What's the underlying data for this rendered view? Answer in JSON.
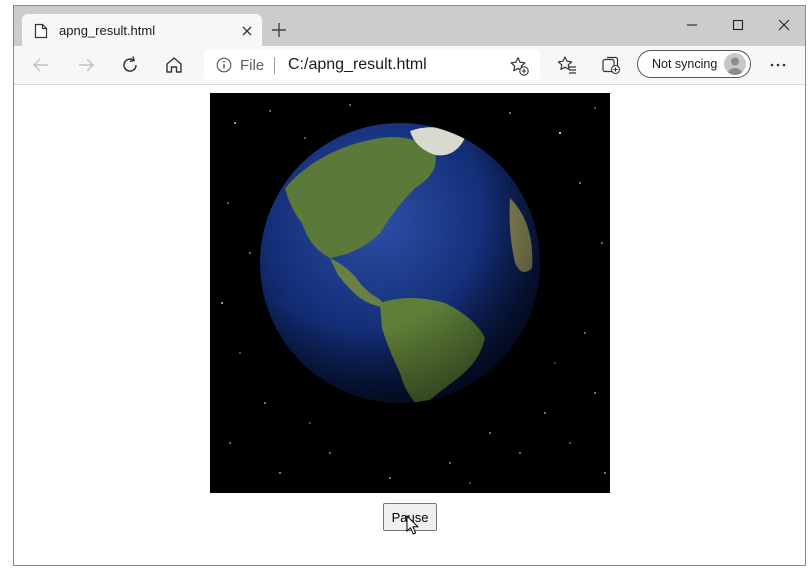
{
  "tab": {
    "title": "apng_result.html"
  },
  "address_bar": {
    "scheme_label": "File",
    "url": "C:/apng_result.html"
  },
  "profile": {
    "sync_label": "Not syncing"
  },
  "content": {
    "button_label": "Pause"
  },
  "icons": [
    "page-icon",
    "close-icon",
    "plus-icon",
    "minimize-icon",
    "maximize-icon",
    "back-arrow-icon",
    "forward-arrow-icon",
    "refresh-icon",
    "home-icon",
    "info-icon",
    "add-favorite-icon",
    "favorites-icon",
    "collections-icon",
    "more-icon",
    "cursor-icon"
  ],
  "colors": {
    "titlebar": "#cccccc",
    "toolbar": "#f7f7f7",
    "space": "#000000",
    "ocean": "#0e2a6e",
    "land": "#5b7a3a"
  }
}
